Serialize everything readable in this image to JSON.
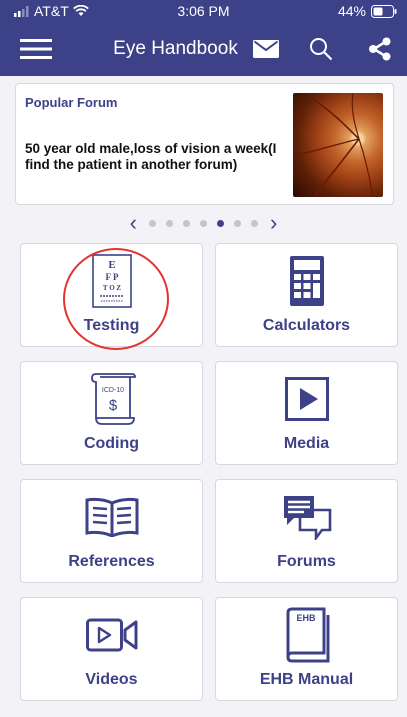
{
  "status_bar": {
    "carrier": "AT&T",
    "time": "3:06 PM",
    "battery": "44%"
  },
  "nav": {
    "title": "Eye Handbook",
    "menu_icon": "menu-icon",
    "mail_icon": "mail-icon",
    "search_icon": "search-icon",
    "share_icon": "share-icon"
  },
  "forum": {
    "label": "Popular Forum",
    "text": "50 year old male,loss of vision a week(I find the patient  in another forum)"
  },
  "pager": {
    "dot_count": 7,
    "active_index": 4
  },
  "tiles": [
    {
      "label": "Testing",
      "icon": "eye-chart-icon",
      "chart_lines": [
        "E",
        "F P",
        "T O Z"
      ]
    },
    {
      "label": "Calculators",
      "icon": "calculator-icon"
    },
    {
      "label": "Coding",
      "icon": "coding-scroll-icon",
      "icon_text": "ICD-10",
      "icon_symbol": "$"
    },
    {
      "label": "Media",
      "icon": "media-play-icon"
    },
    {
      "label": "References",
      "icon": "book-icon"
    },
    {
      "label": "Forums",
      "icon": "forum-chat-icon"
    },
    {
      "label": "Videos",
      "icon": "video-camera-icon"
    },
    {
      "label": "EHB Manual",
      "icon": "manual-book-icon",
      "icon_text": "EHB"
    }
  ],
  "colors": {
    "brand": "#3d4288",
    "highlight": "#e3342f"
  }
}
